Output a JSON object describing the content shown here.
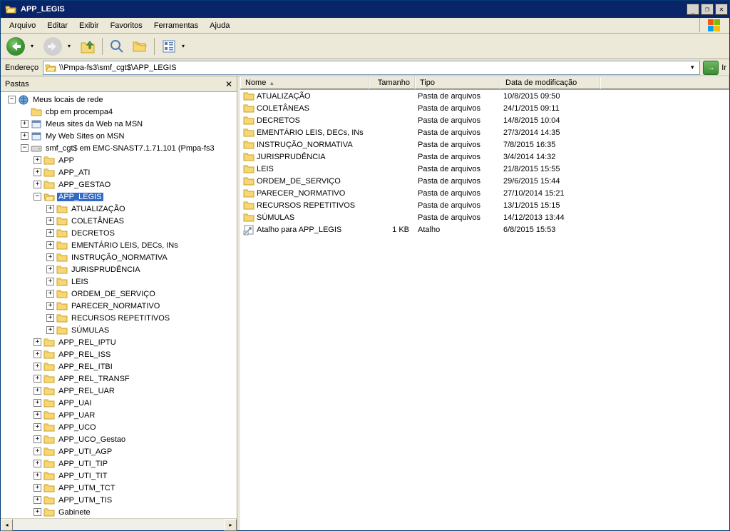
{
  "window": {
    "title": "APP_LEGIS"
  },
  "menu": {
    "items": [
      "Arquivo",
      "Editar",
      "Exibir",
      "Favoritos",
      "Ferramentas",
      "Ajuda"
    ]
  },
  "address": {
    "label": "Endereço",
    "path": "\\\\Pmpa-fs3\\smf_cgt$\\APP_LEGIS",
    "go": "Ir"
  },
  "panel": {
    "title": "Pastas"
  },
  "tree": [
    {
      "d": 0,
      "e": "-",
      "i": "net",
      "t": "Meus locais de rede"
    },
    {
      "d": 1,
      "e": " ",
      "i": "fld",
      "t": "cbp em procempa4"
    },
    {
      "d": 1,
      "e": "+",
      "i": "web",
      "t": "Meus sites da Web na MSN"
    },
    {
      "d": 1,
      "e": "+",
      "i": "web",
      "t": "My Web Sites on MSN"
    },
    {
      "d": 1,
      "e": "-",
      "i": "drv",
      "t": "smf_cgt$ em EMC-SNAST7.1.71.101 (Pmpa-fs3"
    },
    {
      "d": 2,
      "e": "+",
      "i": "fld",
      "t": "APP"
    },
    {
      "d": 2,
      "e": "+",
      "i": "fld",
      "t": "APP_ATI"
    },
    {
      "d": 2,
      "e": "+",
      "i": "fld",
      "t": "APP_GESTAO"
    },
    {
      "d": 2,
      "e": "-",
      "i": "fldO",
      "t": "APP_LEGIS",
      "sel": true
    },
    {
      "d": 3,
      "e": "+",
      "i": "fld",
      "t": "ATUALIZAÇÃO"
    },
    {
      "d": 3,
      "e": "+",
      "i": "fld",
      "t": "COLETÂNEAS"
    },
    {
      "d": 3,
      "e": "+",
      "i": "fld",
      "t": "DECRETOS"
    },
    {
      "d": 3,
      "e": "+",
      "i": "fld",
      "t": "EMENTÁRIO LEIS, DECs, INs"
    },
    {
      "d": 3,
      "e": "+",
      "i": "fld",
      "t": "INSTRUÇÃO_NORMATIVA"
    },
    {
      "d": 3,
      "e": "+",
      "i": "fld",
      "t": "JURISPRUDÊNCIA"
    },
    {
      "d": 3,
      "e": "+",
      "i": "fld",
      "t": "LEIS"
    },
    {
      "d": 3,
      "e": "+",
      "i": "fld",
      "t": "ORDEM_DE_SERVIÇO"
    },
    {
      "d": 3,
      "e": "+",
      "i": "fld",
      "t": "PARECER_NORMATIVO"
    },
    {
      "d": 3,
      "e": "+",
      "i": "fld",
      "t": "RECURSOS REPETITIVOS"
    },
    {
      "d": 3,
      "e": "+",
      "i": "fld",
      "t": "SÚMULAS"
    },
    {
      "d": 2,
      "e": "+",
      "i": "fld",
      "t": "APP_REL_IPTU"
    },
    {
      "d": 2,
      "e": "+",
      "i": "fld",
      "t": "APP_REL_ISS"
    },
    {
      "d": 2,
      "e": "+",
      "i": "fld",
      "t": "APP_REL_ITBI"
    },
    {
      "d": 2,
      "e": "+",
      "i": "fld",
      "t": "APP_REL_TRANSF"
    },
    {
      "d": 2,
      "e": "+",
      "i": "fld",
      "t": "APP_REL_UAR"
    },
    {
      "d": 2,
      "e": "+",
      "i": "fld",
      "t": "APP_UAI"
    },
    {
      "d": 2,
      "e": "+",
      "i": "fld",
      "t": "APP_UAR"
    },
    {
      "d": 2,
      "e": "+",
      "i": "fld",
      "t": "APP_UCO"
    },
    {
      "d": 2,
      "e": "+",
      "i": "fld",
      "t": "APP_UCO_Gestao"
    },
    {
      "d": 2,
      "e": "+",
      "i": "fld",
      "t": "APP_UTI_AGP"
    },
    {
      "d": 2,
      "e": "+",
      "i": "fld",
      "t": "APP_UTI_TIP"
    },
    {
      "d": 2,
      "e": "+",
      "i": "fld",
      "t": "APP_UTI_TIT"
    },
    {
      "d": 2,
      "e": "+",
      "i": "fld",
      "t": "APP_UTM_TCT"
    },
    {
      "d": 2,
      "e": "+",
      "i": "fld",
      "t": "APP_UTM_TIS"
    },
    {
      "d": 2,
      "e": "+",
      "i": "fld",
      "t": "Gabinete"
    }
  ],
  "columns": {
    "name": "Nome",
    "size": "Tamanho",
    "type": "Tipo",
    "date": "Data de modificação"
  },
  "files": [
    {
      "i": "fld",
      "n": "ATUALIZAÇÃO",
      "s": "",
      "t": "Pasta de arquivos",
      "d": "10/8/2015 09:50"
    },
    {
      "i": "fld",
      "n": "COLETÂNEAS",
      "s": "",
      "t": "Pasta de arquivos",
      "d": "24/1/2015 09:11"
    },
    {
      "i": "fld",
      "n": "DECRETOS",
      "s": "",
      "t": "Pasta de arquivos",
      "d": "14/8/2015 10:04"
    },
    {
      "i": "fld",
      "n": "EMENTÁRIO LEIS, DECs, INs",
      "s": "",
      "t": "Pasta de arquivos",
      "d": "27/3/2014 14:35"
    },
    {
      "i": "fld",
      "n": "INSTRUÇÃO_NORMATIVA",
      "s": "",
      "t": "Pasta de arquivos",
      "d": "7/8/2015 16:35"
    },
    {
      "i": "fld",
      "n": "JURISPRUDÊNCIA",
      "s": "",
      "t": "Pasta de arquivos",
      "d": "3/4/2014 14:32"
    },
    {
      "i": "fld",
      "n": "LEIS",
      "s": "",
      "t": "Pasta de arquivos",
      "d": "21/8/2015 15:55"
    },
    {
      "i": "fld",
      "n": "ORDEM_DE_SERVIÇO",
      "s": "",
      "t": "Pasta de arquivos",
      "d": "29/6/2015 15:44"
    },
    {
      "i": "fld",
      "n": "PARECER_NORMATIVO",
      "s": "",
      "t": "Pasta de arquivos",
      "d": "27/10/2014 15:21"
    },
    {
      "i": "fld",
      "n": "RECURSOS REPETITIVOS",
      "s": "",
      "t": "Pasta de arquivos",
      "d": "13/1/2015 15:15"
    },
    {
      "i": "fld",
      "n": "SÚMULAS",
      "s": "",
      "t": "Pasta de arquivos",
      "d": "14/12/2013 13:44"
    },
    {
      "i": "lnk",
      "n": "Atalho para APP_LEGIS",
      "s": "1 KB",
      "t": "Atalho",
      "d": "6/8/2015 15:53"
    }
  ]
}
